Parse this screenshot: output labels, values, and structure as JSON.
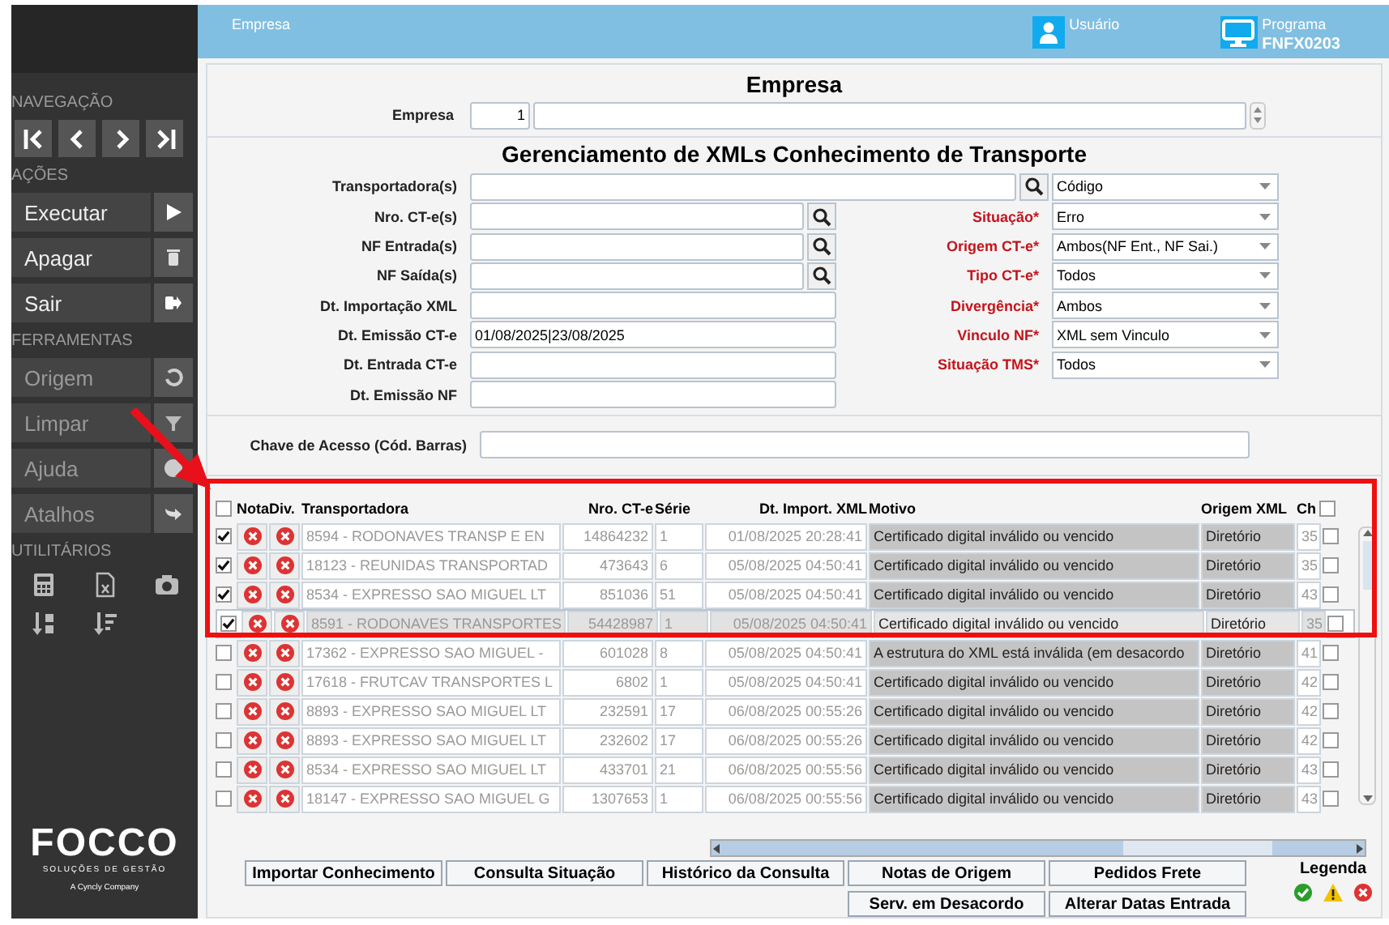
{
  "header": {
    "title": "Empresa",
    "user_label": "Usuário",
    "program_label": "Programa",
    "program_code": "FNFX0203"
  },
  "sidebar": {
    "sections": [
      {
        "title": "NAVEGAÇÃO",
        "kind": "nav"
      },
      {
        "title": "AÇÕES",
        "kind": "actions",
        "items": [
          {
            "label": "Executar",
            "disabled": false
          },
          {
            "label": "Apagar",
            "disabled": false
          },
          {
            "label": "Sair",
            "disabled": false
          }
        ]
      },
      {
        "title": "FERRAMENTAS",
        "kind": "tools",
        "items": [
          {
            "label": "Origem",
            "disabled": true
          },
          {
            "label": "Limpar",
            "disabled": true
          },
          {
            "label": "Ajuda",
            "disabled": true
          },
          {
            "label": "Atalhos",
            "disabled": true
          }
        ]
      },
      {
        "title": "UTILITÁRIOS",
        "kind": "utils"
      }
    ],
    "logo": {
      "name": "FOCCO",
      "tagline": "SOLUÇÕES DE GESTÃO",
      "company": "A Cyncly Company"
    }
  },
  "empresa": {
    "title": "Empresa",
    "label": "Empresa",
    "code": "1"
  },
  "filters": {
    "title": "Gerenciamento de XMLs Conhecimento de Transporte",
    "left": [
      {
        "label": "Transportadora(s)",
        "lookup": true
      },
      {
        "label": "Nro. CT-e(s)",
        "lookup": true
      },
      {
        "label": "NF Entrada(s)",
        "lookup": true
      },
      {
        "label": "NF Saída(s)",
        "lookup": true
      },
      {
        "label": "Dt. Importação XML",
        "lookup": false
      },
      {
        "label": "Dt. Emissão CT-e",
        "value": "01/08/2025|23/08/2025",
        "lookup": false
      },
      {
        "label": "Dt. Entrada CT-e",
        "lookup": false
      },
      {
        "label": "Dt. Emissão NF",
        "lookup": false
      }
    ],
    "right": [
      {
        "value": "Código"
      },
      {
        "label": "Situação*",
        "value": "Erro"
      },
      {
        "label": "Origem CT-e*",
        "value": "Ambos(NF Ent., NF Sai.)"
      },
      {
        "label": "Tipo CT-e*",
        "value": "Todos"
      },
      {
        "label": "Divergência*",
        "value": "Ambos"
      },
      {
        "label": "Vinculo NF*",
        "value": "XML sem Vinculo"
      },
      {
        "label": "Situação TMS*",
        "value": "Todos"
      }
    ],
    "access_key": {
      "label": "Chave de Acesso (Cód. Barras)"
    }
  },
  "table": {
    "all_checked": false,
    "key_all_checked": false,
    "columns": [
      "Nota",
      "Div.",
      "Transportadora",
      "Nro. CT-e",
      "Série",
      "Dt. Import. XML",
      "Motivo",
      "Origem XML",
      "Ch"
    ],
    "rows": [
      {
        "checked": true,
        "selected": false,
        "transportadora": "8594 - RODONAVES TRANSP E EN",
        "nro": "14864232",
        "serie": "1",
        "dt": "01/08/2025 20:28:41",
        "motivo": "Certificado digital inválido ou vencido",
        "origem": "Diretório",
        "chave": "35",
        "key_checked": false
      },
      {
        "checked": true,
        "selected": false,
        "transportadora": "18123 - REUNIDAS TRANSPORTAD",
        "nro": "473643",
        "serie": "6",
        "dt": "05/08/2025 04:50:41",
        "motivo": "Certificado digital inválido ou vencido",
        "origem": "Diretório",
        "chave": "35",
        "key_checked": false
      },
      {
        "checked": true,
        "selected": false,
        "transportadora": "8534 - EXPRESSO SAO MIGUEL LT",
        "nro": "851036",
        "serie": "51",
        "dt": "05/08/2025 04:50:41",
        "motivo": "Certificado digital inválido ou vencido",
        "origem": "Diretório",
        "chave": "43",
        "key_checked": false
      },
      {
        "checked": true,
        "selected": true,
        "transportadora": "8591 - RODONAVES TRANSPORTES",
        "nro": "54428987",
        "serie": "1",
        "dt": "05/08/2025 04:50:41",
        "motivo": "Certificado digital inválido ou vencido",
        "origem": "Diretório",
        "chave": "35",
        "key_checked": false
      },
      {
        "checked": false,
        "selected": false,
        "transportadora": "17362 - EXPRESSO SAO MIGUEL -",
        "nro": "601028",
        "serie": "8",
        "dt": "05/08/2025 04:50:41",
        "motivo": "A estrutura do XML está inválida (em desacordo",
        "origem": "Diretório",
        "chave": "41",
        "key_checked": false
      },
      {
        "checked": false,
        "selected": false,
        "transportadora": "17618 - FRUTCAV TRANSPORTES L",
        "nro": "6802",
        "serie": "1",
        "dt": "05/08/2025 04:50:41",
        "motivo": "Certificado digital inválido ou vencido",
        "origem": "Diretório",
        "chave": "42",
        "key_checked": false
      },
      {
        "checked": false,
        "selected": false,
        "transportadora": "8893 - EXPRESSO SAO MIGUEL LT",
        "nro": "232591",
        "serie": "17",
        "dt": "06/08/2025 00:55:26",
        "motivo": "Certificado digital inválido ou vencido",
        "origem": "Diretório",
        "chave": "42",
        "key_checked": false
      },
      {
        "checked": false,
        "selected": false,
        "transportadora": "8893 - EXPRESSO SAO MIGUEL LT",
        "nro": "232602",
        "serie": "17",
        "dt": "06/08/2025 00:55:26",
        "motivo": "Certificado digital inválido ou vencido",
        "origem": "Diretório",
        "chave": "42",
        "key_checked": false
      },
      {
        "checked": false,
        "selected": false,
        "transportadora": "8534 - EXPRESSO SAO MIGUEL LT",
        "nro": "433701",
        "serie": "21",
        "dt": "06/08/2025 00:55:56",
        "motivo": "Certificado digital inválido ou vencido",
        "origem": "Diretório",
        "chave": "43",
        "key_checked": false
      },
      {
        "checked": false,
        "selected": false,
        "transportadora": "18147 - EXPRESSO SAO MIGUEL G",
        "nro": "1307653",
        "serie": "1",
        "dt": "06/08/2025 00:55:56",
        "motivo": "Certificado digital inválido ou vencido",
        "origem": "Diretório",
        "chave": "43",
        "key_checked": false
      }
    ]
  },
  "buttons": [
    [
      "Importar Conhecimento",
      "Consulta Situação",
      "Histórico da Consulta",
      "Notas de Origem",
      "Pedidos Frete"
    ],
    [
      "Serv. em Desacordo",
      "Alterar Datas Entrada"
    ]
  ],
  "legend": {
    "title": "Legenda",
    "items": [
      {
        "kind": "ok"
      },
      {
        "kind": "warning"
      },
      {
        "kind": "error"
      }
    ]
  }
}
